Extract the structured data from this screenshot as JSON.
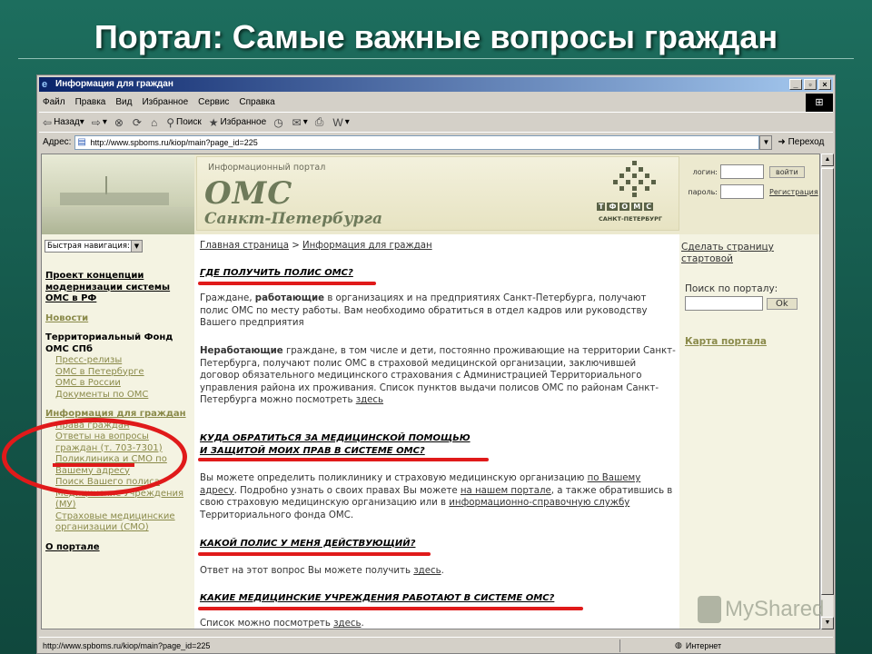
{
  "slide": {
    "title": "Портал: Самые важные вопросы граждан"
  },
  "window": {
    "title": "Информация для граждан"
  },
  "menu": [
    "Файл",
    "Правка",
    "Вид",
    "Избранное",
    "Сервис",
    "Справка"
  ],
  "toolbar": {
    "back": "Назад",
    "search": "Поиск",
    "favorites": "Избранное"
  },
  "address": {
    "label": "Адрес:",
    "url": "http://www.spboms.ru/kiop/main?page_id=225",
    "go": "Переход"
  },
  "status": {
    "url": "http://www.spboms.ru/kiop/main?page_id=225",
    "zone": "Интернет"
  },
  "banner": {
    "small": "Информационный портал",
    "oms": "ОМС",
    "city": "Санкт-Петербурга",
    "logo": [
      "Т",
      "Ф",
      "О",
      "М",
      "С"
    ],
    "logo_sub": "САНКТ-ПЕТЕРБУРГ"
  },
  "login": {
    "login_label": "логин:",
    "password_label": "пароль:",
    "submit": "войти",
    "register": "Регистрация"
  },
  "left_nav": {
    "quicknav": "Быстрая навигация:",
    "project": "Проект концепции модернизации системы ОМС в РФ",
    "news": "Новости",
    "fund": "Территориальный Фонд ОМС СПб",
    "fund_items": [
      "Пресс-релизы",
      "ОМС в Петербурге",
      "ОМС в России",
      "Документы по ОМС"
    ],
    "info": "Информация для граждан",
    "info_items": [
      "Права граждан",
      "Ответы на вопросы граждан (т. 703-7301)",
      "Поликлиника и СМО по Вашему адресу",
      "Поиск Вашего полиса",
      "Медицинские Учреждения (МУ)",
      "Страховые медицинские организации (СМО)"
    ],
    "about": "О портале"
  },
  "main": {
    "crumb_home": "Главная страница",
    "crumb_sep": ">",
    "crumb_current": "Информация для граждан",
    "q1": "ГДЕ ПОЛУЧИТЬ ПОЛИС ОМС?",
    "p1_a": "Граждане, ",
    "p1_b": "работающие",
    "p1_c": " в организациях и на предприятиях Санкт-Петербурга, получают полис ОМС по месту работы. Вам необходимо обратиться в отдел кадров или руководству Вашего предприятия",
    "p2_b": "Неработающие",
    "p2_a": " граждане, в том числе и дети, постоянно проживающие на территории Санкт-Петербурга, получают полис ОМС в страховой медицинской организации, заключившей договор обязательного медицинского страхования с Администрацией Территориального управления района их проживания.",
    "p2_c": "Список пунктов выдачи полисов ОМС по районам Санкт-Петербурга можно посмотреть ",
    "p2_link": "здесь",
    "q2a": "КУДА ОБРАТИТЬСЯ ЗА МЕДИЦИНСКОЙ ПОМОЩЬЮ",
    "q2b": "И ЗАЩИТОЙ МОИХ ПРАВ В СИСТЕМЕ ОМС?",
    "p3_a": "Вы можете определить поликлинику и страховую медицинскую организацию ",
    "p3_l1": "по Вашему адресу",
    "p3_b": ". Подробно узнать о своих правах Вы можете ",
    "p3_l2": "на нашем портале",
    "p3_c": ", а также обратившись в свою страховую медицинскую организацию или в ",
    "p3_l3": "информационно-справочную службу",
    "p3_d": " Территориального фонда ОМС.",
    "q3": "КАКОЙ ПОЛИС У МЕНЯ ДЕЙСТВУЮЩИЙ?",
    "p4_a": "Ответ на этот вопрос Вы можете получить ",
    "p4_link": "здесь",
    "q4": "КАКИЕ МЕДИЦИНСКИЕ УЧРЕЖДЕНИЯ РАБОТАЮТ В СИСТЕМЕ ОМС?",
    "p5_a": "Список можно посмотреть ",
    "p5_link": "здесь"
  },
  "right": {
    "make_start": "Сделать страницу стартовой",
    "search_label": "Поиск по порталу:",
    "search_btn": "Ok",
    "sitemap": "Карта портала"
  },
  "watermark": "MyShared",
  "colors": {
    "highlight": "#e01a1a",
    "slide_bg": "#1d6e5e",
    "portal_olive": "#8a8a4a"
  }
}
